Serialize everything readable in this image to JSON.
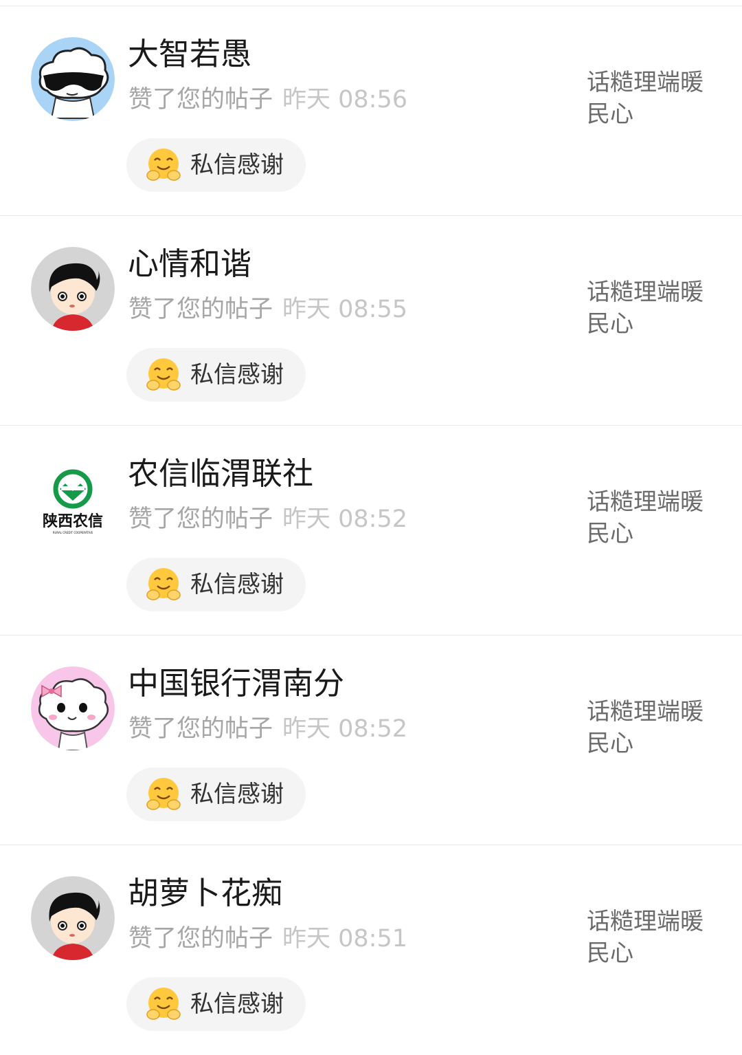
{
  "items": [
    {
      "name": "大智若愚",
      "action": "赞了您的帖子",
      "time": "昨天 08:56",
      "button_label": "私信感谢",
      "post_title": "话糙理端暖民心",
      "avatar_icon": "cloud-sunglasses-avatar-icon"
    },
    {
      "name": "心情和谐",
      "action": "赞了您的帖子",
      "time": "昨天 08:55",
      "button_label": "私信感谢",
      "post_title": "话糙理端暖民心",
      "avatar_icon": "cartoon-boy-avatar-icon"
    },
    {
      "name": "农信临渭联社",
      "action": "赞了您的帖子",
      "time": "昨天 08:52",
      "button_label": "私信感谢",
      "post_title": "话糙理端暖民心",
      "avatar_icon": "shaanxi-rural-credit-logo-icon",
      "avatar_logo_text": "陕西农信",
      "avatar_logo_subtext": "RURAL CREDIT COOPERATIVE"
    },
    {
      "name": "中国银行渭南分",
      "action": "赞了您的帖子",
      "time": "昨天 08:52",
      "button_label": "私信感谢",
      "post_title": "话糙理端暖民心",
      "avatar_icon": "pink-cloud-bow-avatar-icon"
    },
    {
      "name": "胡萝卜花痴",
      "action": "赞了您的帖子",
      "time": "昨天 08:51",
      "button_label": "私信感谢",
      "post_title": "话糙理端暖民心",
      "avatar_icon": "cartoon-boy-avatar-icon"
    }
  ],
  "colors": {
    "name": "#1a1a1a",
    "action": "#a6a6a6",
    "time": "#c6c6c6",
    "button_bg": "#f4f4f4",
    "post_title": "#6b6b6b",
    "logo_green": "#159a4a"
  },
  "button_icon": "hugging-face-emoji-icon"
}
